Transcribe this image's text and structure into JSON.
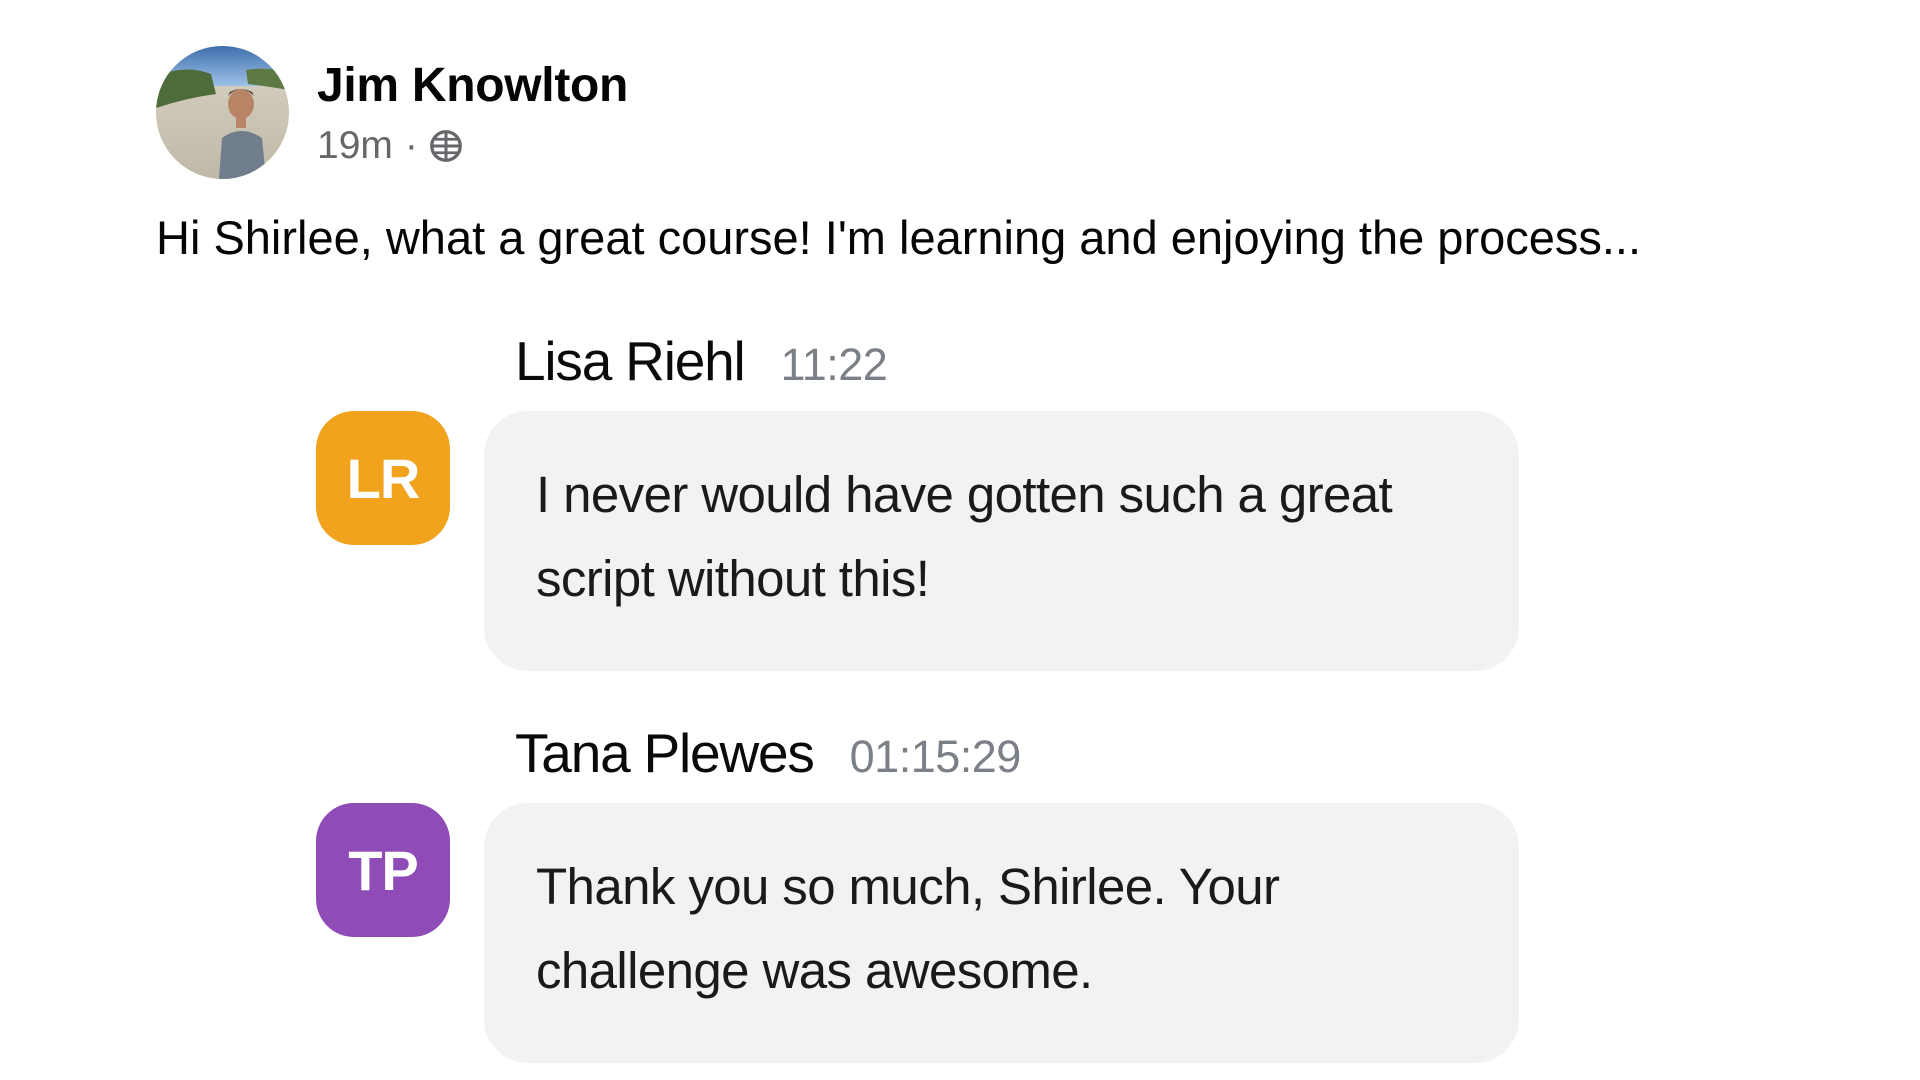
{
  "post": {
    "author": "Jim Knowlton",
    "time": "19m",
    "separator": "·",
    "visibility_icon": "globe-icon",
    "text": "Hi Shirlee, what a great course! I'm learning and enjoying the process..."
  },
  "comments": [
    {
      "name": "Lisa Riehl",
      "time": "11:22",
      "initials": "LR",
      "avatar_color": "#f2a31e",
      "text": "I never would have gotten such a great script without this!"
    },
    {
      "name": "Tana Plewes",
      "time": "01:15:29",
      "initials": "TP",
      "avatar_color": "#8f4bb6",
      "text": "Thank you so much, Shirlee. Your challenge was awesome."
    }
  ],
  "colors": {
    "bubble_bg": "#f2f2f5",
    "secondary_text": "#65676b"
  }
}
